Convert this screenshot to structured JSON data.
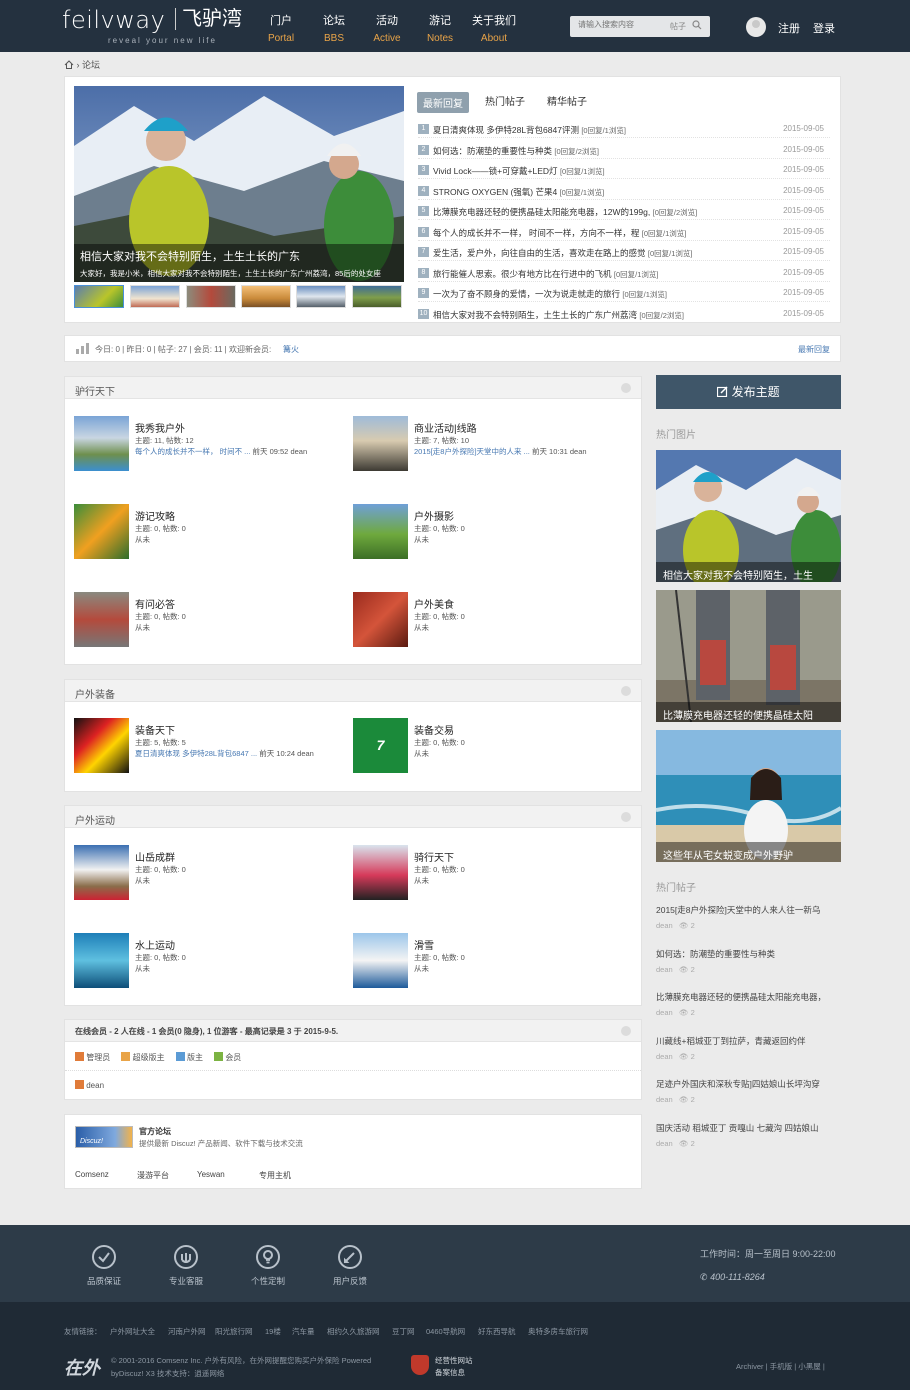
{
  "header": {
    "logo_text": "feilvway",
    "logo_cn": "飞驴湾",
    "logo_tagline": "reveal your new life",
    "nav": [
      {
        "cn": "门户",
        "en": "Portal"
      },
      {
        "cn": "论坛",
        "en": "BBS"
      },
      {
        "cn": "活动",
        "en": "Active"
      },
      {
        "cn": "游记",
        "en": "Notes"
      },
      {
        "cn": "关于我们",
        "en": "About"
      }
    ],
    "search_placeholder": "请输入搜索内容",
    "search_type": "帖子",
    "register": "注册",
    "login": "登录"
  },
  "breadcrumb": {
    "current": "论坛"
  },
  "slider": {
    "title": "相信大家对我不会特别陌生，土生土长的广东",
    "desc": "大家好，我是小米，相信大家对我不会特别陌生，土生土长的广东广州荔湾，85后的处女座"
  },
  "tabs": [
    "最新回复",
    "热门帖子",
    "精华帖子"
  ],
  "news": [
    {
      "n": "1",
      "title": "夏日清爽体现 多伊特28L背包6847评测",
      "meta": "[0回复/1浏览]",
      "date": "2015-09-05"
    },
    {
      "n": "2",
      "title": "如何选：防潮垫的重要性与种类",
      "meta": "[0回复/2浏览]",
      "date": "2015-09-05"
    },
    {
      "n": "3",
      "title": "Vivid Lock——锁+可穿戴+LED灯",
      "meta": "[0回复/1浏览]",
      "date": "2015-09-05"
    },
    {
      "n": "4",
      "title": "STRONG OXYGEN (强氧) 芒果4",
      "meta": "[0回复/1浏览]",
      "date": "2015-09-05"
    },
    {
      "n": "5",
      "title": "比薄膜充电器还轻的便携晶硅太阳能充电器，12W的199g,",
      "meta": "[0回复/2浏览]",
      "date": "2015-09-05"
    },
    {
      "n": "6",
      "title": "每个人的成长并不一样， 时间不一样，方向不一样，程",
      "meta": "[0回复/1浏览]",
      "date": "2015-09-05"
    },
    {
      "n": "7",
      "title": "爱生活，爱户外，向往自由的生活，喜欢走在路上的感觉",
      "meta": "[0回复/1浏览]",
      "date": "2015-09-05"
    },
    {
      "n": "8",
      "title": "旅行能催人思索。很少有地方比在行进中的飞机",
      "meta": "[0回复/1浏览]",
      "date": "2015-09-05"
    },
    {
      "n": "9",
      "title": "一次为了奋不顾身的爱情，一次为说走就走的旅行",
      "meta": "[0回复/1浏览]",
      "date": "2015-09-05"
    },
    {
      "n": "10",
      "title": "相信大家对我不会特别陌生，土生土长的广东广州荔湾",
      "meta": "[0回复/2浏览]",
      "date": "2015-09-05"
    }
  ],
  "stats": {
    "text": "今日: 0 | 昨日: 0 | 帖子: 27 | 会员: 11 | 欢迎新会员:",
    "new_member": "篝火",
    "latest_reply": "最新回复"
  },
  "sections": [
    {
      "title": "驴行天下",
      "forums": [
        {
          "name": "我秀我户外",
          "counts": "主题: 11, 帖数: 12",
          "last_title": "每个人的成长并不一样， 时间不 ...",
          "last_meta": " 前天 09:52 dean"
        },
        {
          "name": "商业活动|线路",
          "counts": "主题: 7, 帖数: 10",
          "last_title": "2015[走8户外探险]天堂中的人来 ...",
          "last_meta": " 前天 10:31 dean"
        },
        {
          "name": "游记攻略",
          "counts": "主题: 0, 帖数: 0",
          "last_title": "",
          "last_meta": "从未"
        },
        {
          "name": "户外摄影",
          "counts": "主题: 0, 帖数: 0",
          "last_title": "",
          "last_meta": "从未"
        },
        {
          "name": "有问必答",
          "counts": "主题: 0, 帖数: 0",
          "last_title": "",
          "last_meta": "从未"
        },
        {
          "name": "户外美食",
          "counts": "主题: 0, 帖数: 0",
          "last_title": "",
          "last_meta": "从未"
        }
      ]
    },
    {
      "title": "户外装备",
      "forums": [
        {
          "name": "装备天下",
          "counts": "主题: 5, 帖数: 5",
          "last_title": "夏日清爽体现 多伊特28L背包6847 ...",
          "last_meta": " 前天 10:24 dean"
        },
        {
          "name": "装备交易",
          "counts": "主题: 0, 帖数: 0",
          "last_title": "",
          "last_meta": "从未"
        }
      ]
    },
    {
      "title": "户外运动",
      "forums": [
        {
          "name": "山岳成群",
          "counts": "主题: 0, 帖数: 0",
          "last_title": "",
          "last_meta": "从未"
        },
        {
          "name": "骑行天下",
          "counts": "主题: 0, 帖数: 0",
          "last_title": "",
          "last_meta": "从未"
        },
        {
          "name": "水上运动",
          "counts": "主题: 0, 帖数: 0",
          "last_title": "",
          "last_meta": "从未"
        },
        {
          "name": "滑雪",
          "counts": "主题: 0, 帖数: 0",
          "last_title": "",
          "last_meta": "从未"
        }
      ]
    }
  ],
  "online": {
    "title": "在线会员 - 2 人在线 - 1 会员(0 隐身), 1 位游客 - 最高记录是 3 于 2015-9-5.",
    "legend": [
      "管理员",
      "超级版主",
      "版主",
      "会员"
    ],
    "members": [
      "dean"
    ]
  },
  "links": {
    "official_title": "官方论坛",
    "official_desc": "提供最新 Discuz! 产品新闻、软件下载与技术交流",
    "logo_text": "Discuz!",
    "items": [
      "Comsenz",
      "漫游平台",
      "Yeswan",
      "专用主机"
    ]
  },
  "sidebar": {
    "post_button": "发布主题",
    "hot_images_title": "热门图片",
    "hot_images": [
      "相信大家对我不会特别陌生，土生",
      "比薄膜充电器还轻的便携晶硅太阳",
      "这些年从宅女蜕变成户外野驴"
    ],
    "hot_posts_title": "热门帖子",
    "hot_posts": [
      {
        "title": "2015[走8户外探险]天堂中的人来人往一新乌",
        "author": "dean",
        "views": "2"
      },
      {
        "title": "如何选：防潮垫的重要性与种类",
        "author": "dean",
        "views": "2"
      },
      {
        "title": "比薄膜充电器还轻的便携晶硅太阳能充电器，",
        "author": "dean",
        "views": "2"
      },
      {
        "title": "川藏线+稻城亚丁到拉萨，青藏返回约伴",
        "author": "dean",
        "views": "2"
      },
      {
        "title": "足迹户外国庆和深秋专贴]四姑娘山长坪沟穿",
        "author": "dean",
        "views": "2"
      },
      {
        "title": "国庆活动 稻城亚丁 贡嘎山 七藏沟 四姑娘山",
        "author": "dean",
        "views": "2"
      }
    ]
  },
  "footer": {
    "services": [
      "品质保证",
      "专业客服",
      "个性定制",
      "用户反馈"
    ],
    "hours": "工作时间：周一至周日 9:00-22:00",
    "phone": "400-111-8264",
    "links_label": "友情链接：",
    "links": [
      "户外网址大全",
      "河南户外网",
      "阳光旅行网",
      "19楼",
      "汽车量",
      "相约久久旅游网",
      "豆丁网",
      "0460导航网",
      "好东西导航",
      "奥特多房车旅行网"
    ],
    "copyright": "© 2001-2016 Comsenz Inc. 户外有风险，在外网提醒您购买户外保险  Powered",
    "powered": "byDiscuz! X3  技术支持：逍遥网络",
    "badge1": "经营性网站",
    "badge2": "备案信息",
    "bottom_links": "Archiver | 手机版 | 小黑屋 |",
    "logo": "在外"
  },
  "colors": {
    "header_bg": "#24313f",
    "accent": "#e9a448",
    "post_button": "#3f5669",
    "link": "#4778b2"
  }
}
